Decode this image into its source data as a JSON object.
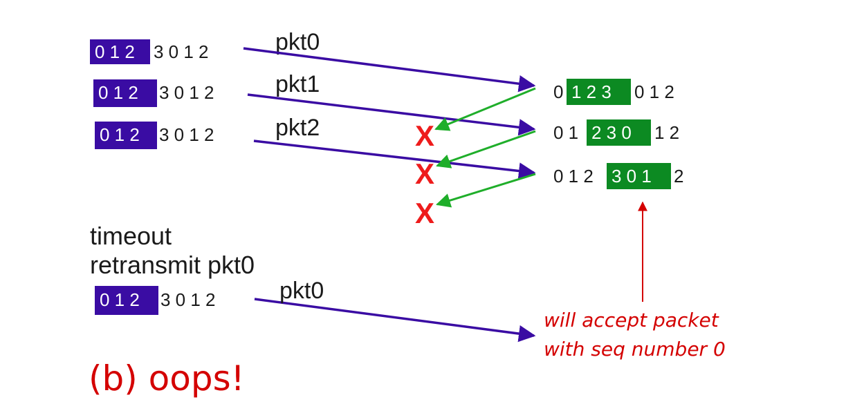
{
  "sender": {
    "rows": [
      {
        "window": "0 1 2",
        "rest": "3 0 1 2",
        "packet_label": "pkt0"
      },
      {
        "window": "0 1 2",
        "rest": "3 0 1 2",
        "packet_label": "pkt1"
      },
      {
        "window": "0 1 2",
        "rest": "3 0 1 2",
        "packet_label": "pkt2"
      }
    ],
    "timeout_line1": "timeout",
    "timeout_line2": "retransmit pkt0",
    "retransmit_row": {
      "window": "0 1 2",
      "rest": "3 0 1 2",
      "packet_label": "pkt0"
    }
  },
  "receiver": {
    "rows": [
      {
        "before": "0",
        "window": "1 2 3",
        "after": "0 1 2"
      },
      {
        "before": "0 1",
        "window": "2 3 0",
        "after": "1 2"
      },
      {
        "before": "0 1 2",
        "window": "3 0 1",
        "after": "2"
      }
    ]
  },
  "loss_marker": "X",
  "annotation": {
    "line1": "will accept packet",
    "line2": "with seq number 0"
  },
  "caption": "(b) oops!",
  "colors": {
    "sender_window": "#3a0ca3",
    "receiver_window": "#0c8a22",
    "data_arrow": "#3a0ca3",
    "ack_arrow": "#1fae2a",
    "loss": "#ee1c1c",
    "annotation": "#d40000"
  }
}
